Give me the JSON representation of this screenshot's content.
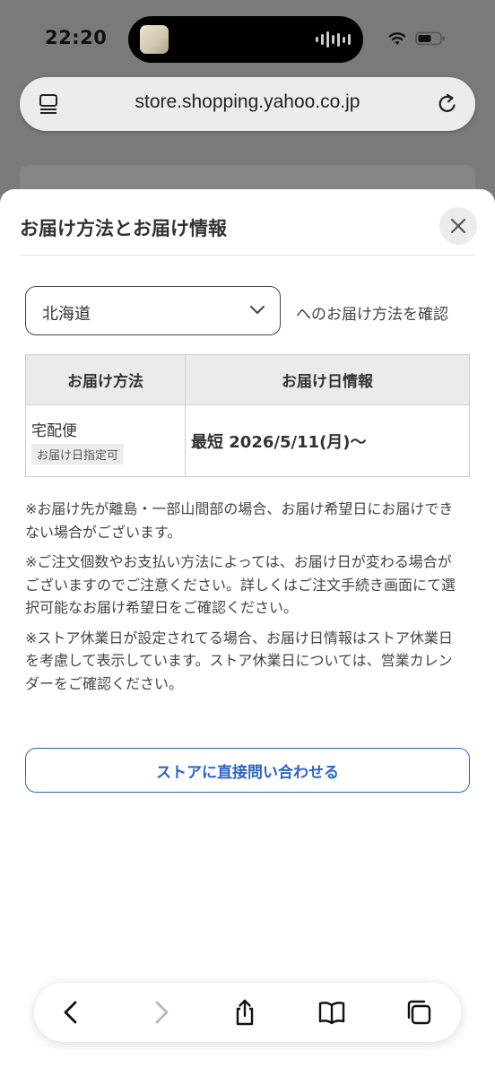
{
  "status_bar": {
    "time": "22:20"
  },
  "browser": {
    "url": "store.shopping.yahoo.co.jp"
  },
  "sheet": {
    "title": "お届け方法とお届け情報",
    "prefecture": {
      "selected": "北海道",
      "suffix": "へのお届け方法を確認"
    },
    "table": {
      "headers": [
        "お届け方法",
        "お届け日情報"
      ],
      "rows": [
        {
          "method": "宅配便",
          "badge": "お届け日指定可",
          "date": "最短 2026/5/11(月)〜"
        }
      ]
    },
    "notes": [
      "※お届け先が離島・一部山間部の場合、お届け希望日にお届けできない場合がございます。",
      "※ご注文個数やお支払い方法によっては、お届け日が変わる場合がございますのでご注意ください。詳しくはご注文手続き画面にて選択可能なお届け希望日をご確認ください。",
      "※ストア休業日が設定されてる場合、お届け日情報はストア休業日を考慮して表示しています。ストア休業日については、営業カレンダーをご確認ください。"
    ],
    "contact_button": "ストアに直接問い合わせる"
  },
  "toolbar": {
    "icons": [
      "back-icon",
      "forward-icon",
      "share-icon",
      "bookmarks-icon",
      "tabs-icon"
    ]
  },
  "colors": {
    "accent": "#2d64c8",
    "overlay": "#7a7a7a"
  }
}
